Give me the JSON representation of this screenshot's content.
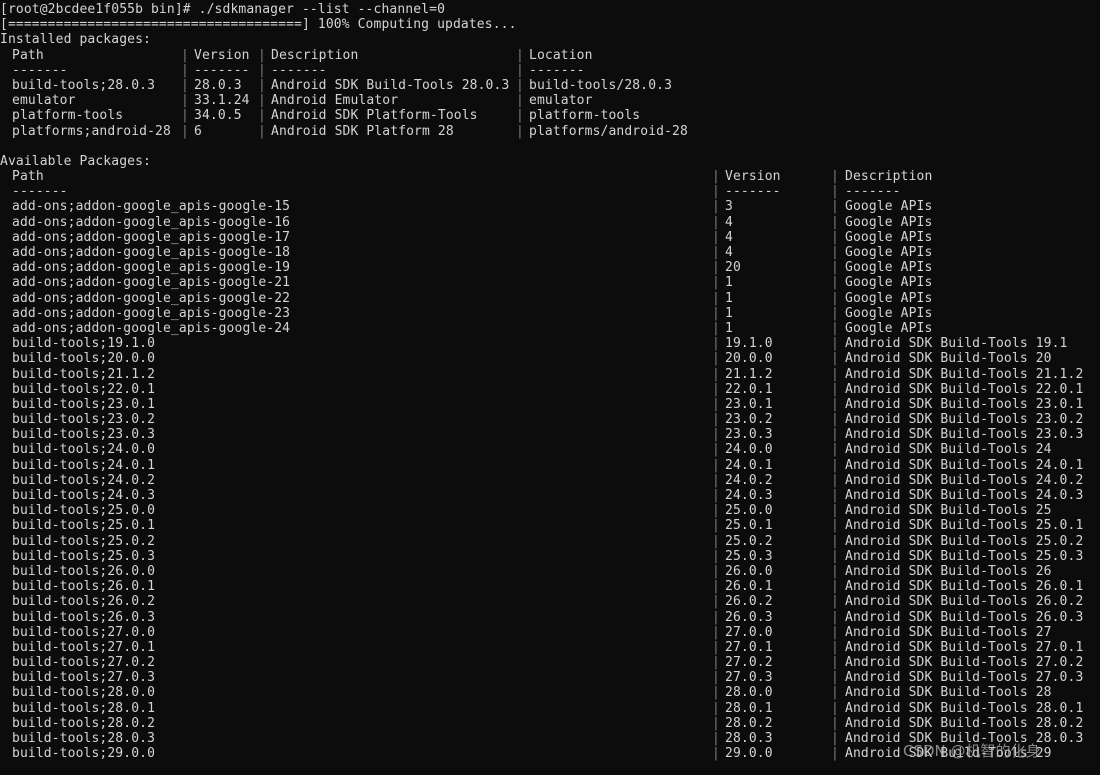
{
  "terminal": {
    "prompt_line": "[root@2bcdee1f055b bin]# ./sdkmanager --list --channel=0",
    "progress_line": "[=====================================] 100% Computing updates...",
    "installed_heading": "Installed packages:",
    "available_heading": "Available Packages:",
    "underline": "-------",
    "watermark": "CSDN @机智的化身"
  },
  "installed_table": {
    "headers": {
      "path": "Path",
      "version": "Version",
      "description": "Description",
      "location": "Location"
    },
    "rows": [
      {
        "path": "build-tools;28.0.3",
        "version": "28.0.3",
        "description": "Android SDK Build-Tools 28.0.3",
        "location": "build-tools/28.0.3"
      },
      {
        "path": "emulator",
        "version": "33.1.24",
        "description": "Android Emulator",
        "location": "emulator"
      },
      {
        "path": "platform-tools",
        "version": "34.0.5",
        "description": "Android SDK Platform-Tools",
        "location": "platform-tools"
      },
      {
        "path": "platforms;android-28",
        "version": "6",
        "description": "Android SDK Platform 28",
        "location": "platforms/android-28"
      }
    ]
  },
  "available_table": {
    "headers": {
      "path": "Path",
      "version": "Version",
      "description": "Description"
    },
    "rows": [
      {
        "path": "add-ons;addon-google_apis-google-15",
        "version": "3",
        "description": "Google APIs"
      },
      {
        "path": "add-ons;addon-google_apis-google-16",
        "version": "4",
        "description": "Google APIs"
      },
      {
        "path": "add-ons;addon-google_apis-google-17",
        "version": "4",
        "description": "Google APIs"
      },
      {
        "path": "add-ons;addon-google_apis-google-18",
        "version": "4",
        "description": "Google APIs"
      },
      {
        "path": "add-ons;addon-google_apis-google-19",
        "version": "20",
        "description": "Google APIs"
      },
      {
        "path": "add-ons;addon-google_apis-google-21",
        "version": "1",
        "description": "Google APIs"
      },
      {
        "path": "add-ons;addon-google_apis-google-22",
        "version": "1",
        "description": "Google APIs"
      },
      {
        "path": "add-ons;addon-google_apis-google-23",
        "version": "1",
        "description": "Google APIs"
      },
      {
        "path": "add-ons;addon-google_apis-google-24",
        "version": "1",
        "description": "Google APIs"
      },
      {
        "path": "build-tools;19.1.0",
        "version": "19.1.0",
        "description": "Android SDK Build-Tools 19.1"
      },
      {
        "path": "build-tools;20.0.0",
        "version": "20.0.0",
        "description": "Android SDK Build-Tools 20"
      },
      {
        "path": "build-tools;21.1.2",
        "version": "21.1.2",
        "description": "Android SDK Build-Tools 21.1.2"
      },
      {
        "path": "build-tools;22.0.1",
        "version": "22.0.1",
        "description": "Android SDK Build-Tools 22.0.1"
      },
      {
        "path": "build-tools;23.0.1",
        "version": "23.0.1",
        "description": "Android SDK Build-Tools 23.0.1"
      },
      {
        "path": "build-tools;23.0.2",
        "version": "23.0.2",
        "description": "Android SDK Build-Tools 23.0.2"
      },
      {
        "path": "build-tools;23.0.3",
        "version": "23.0.3",
        "description": "Android SDK Build-Tools 23.0.3"
      },
      {
        "path": "build-tools;24.0.0",
        "version": "24.0.0",
        "description": "Android SDK Build-Tools 24"
      },
      {
        "path": "build-tools;24.0.1",
        "version": "24.0.1",
        "description": "Android SDK Build-Tools 24.0.1"
      },
      {
        "path": "build-tools;24.0.2",
        "version": "24.0.2",
        "description": "Android SDK Build-Tools 24.0.2"
      },
      {
        "path": "build-tools;24.0.3",
        "version": "24.0.3",
        "description": "Android SDK Build-Tools 24.0.3"
      },
      {
        "path": "build-tools;25.0.0",
        "version": "25.0.0",
        "description": "Android SDK Build-Tools 25"
      },
      {
        "path": "build-tools;25.0.1",
        "version": "25.0.1",
        "description": "Android SDK Build-Tools 25.0.1"
      },
      {
        "path": "build-tools;25.0.2",
        "version": "25.0.2",
        "description": "Android SDK Build-Tools 25.0.2"
      },
      {
        "path": "build-tools;25.0.3",
        "version": "25.0.3",
        "description": "Android SDK Build-Tools 25.0.3"
      },
      {
        "path": "build-tools;26.0.0",
        "version": "26.0.0",
        "description": "Android SDK Build-Tools 26"
      },
      {
        "path": "build-tools;26.0.1",
        "version": "26.0.1",
        "description": "Android SDK Build-Tools 26.0.1"
      },
      {
        "path": "build-tools;26.0.2",
        "version": "26.0.2",
        "description": "Android SDK Build-Tools 26.0.2"
      },
      {
        "path": "build-tools;26.0.3",
        "version": "26.0.3",
        "description": "Android SDK Build-Tools 26.0.3"
      },
      {
        "path": "build-tools;27.0.0",
        "version": "27.0.0",
        "description": "Android SDK Build-Tools 27"
      },
      {
        "path": "build-tools;27.0.1",
        "version": "27.0.1",
        "description": "Android SDK Build-Tools 27.0.1"
      },
      {
        "path": "build-tools;27.0.2",
        "version": "27.0.2",
        "description": "Android SDK Build-Tools 27.0.2"
      },
      {
        "path": "build-tools;27.0.3",
        "version": "27.0.3",
        "description": "Android SDK Build-Tools 27.0.3"
      },
      {
        "path": "build-tools;28.0.0",
        "version": "28.0.0",
        "description": "Android SDK Build-Tools 28"
      },
      {
        "path": "build-tools;28.0.1",
        "version": "28.0.1",
        "description": "Android SDK Build-Tools 28.0.1"
      },
      {
        "path": "build-tools;28.0.2",
        "version": "28.0.2",
        "description": "Android SDK Build-Tools 28.0.2"
      },
      {
        "path": "build-tools;28.0.3",
        "version": "28.0.3",
        "description": "Android SDK Build-Tools 28.0.3"
      },
      {
        "path": "build-tools;29.0.0",
        "version": "29.0.0",
        "description": "Android SDK Build-Tools 29"
      }
    ]
  },
  "colors": {
    "background": "#0c0c0c",
    "foreground": "#d4d4d4",
    "separator": "#7a7a82"
  }
}
